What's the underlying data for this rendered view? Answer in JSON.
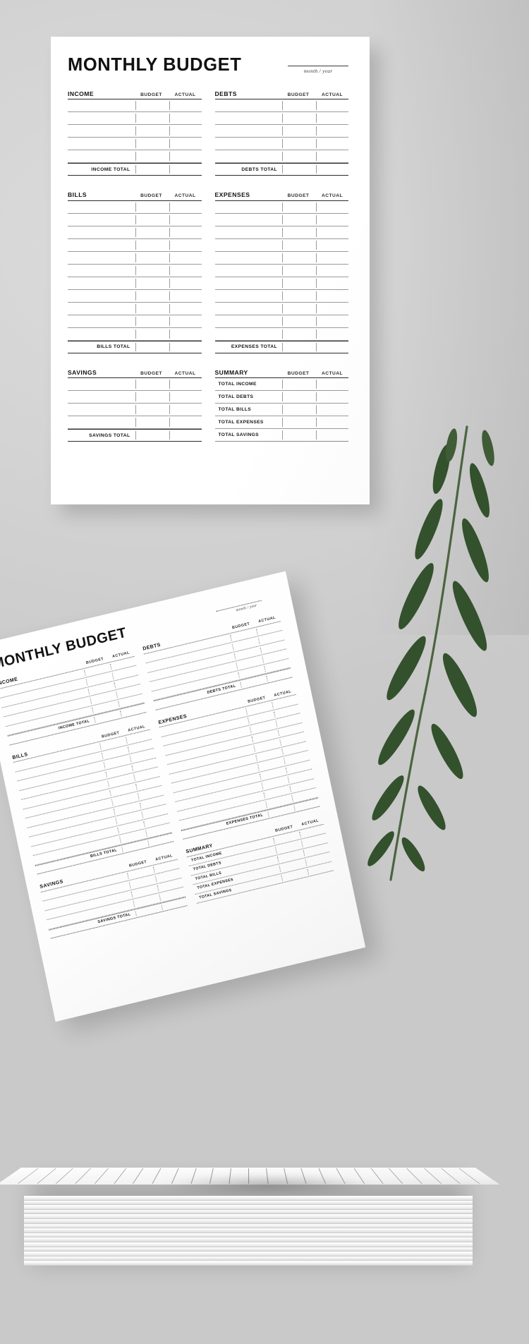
{
  "document": {
    "title": "MONTHLY BUDGET",
    "month_year_label": "month / year",
    "col_budget": "BUDGET",
    "col_actual": "ACTUAL"
  },
  "sections": {
    "income": {
      "title": "INCOME",
      "total_label": "INCOME TOTAL",
      "blank_rows": 5
    },
    "debts": {
      "title": "DEBTS",
      "total_label": "DEBTS TOTAL",
      "blank_rows": 5
    },
    "bills": {
      "title": "BILLS",
      "total_label": "BILLS TOTAL",
      "blank_rows": 11
    },
    "expenses": {
      "title": "EXPENSES",
      "total_label": "EXPENSES TOTAL",
      "blank_rows": 11
    },
    "savings": {
      "title": "SAVINGS",
      "total_label": "SAVINGS TOTAL",
      "blank_rows": 4
    },
    "summary": {
      "title": "SUMMARY",
      "rows": [
        "TOTAL INCOME",
        "TOTAL DEBTS",
        "TOTAL BILLS",
        "TOTAL EXPENSES",
        "TOTAL SAVINGS"
      ]
    }
  },
  "colors": {
    "background": "#d2d2d2",
    "paper": "#ffffff",
    "ink": "#111111",
    "rule": "#9b9b9b",
    "heavy_rule": "#2b2b2b",
    "leaf_dark": "#2f4a2b",
    "leaf_mid": "#3d5c33",
    "stem": "#46603a"
  }
}
